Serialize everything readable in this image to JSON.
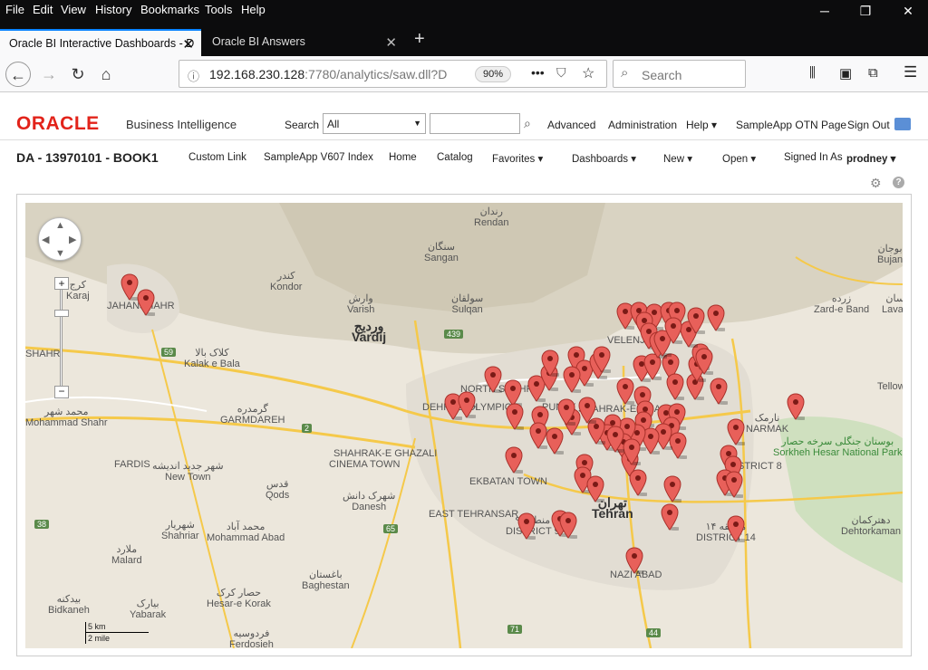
{
  "browser": {
    "menu": [
      "File",
      "Edit",
      "View",
      "History",
      "Bookmarks",
      "Tools",
      "Help"
    ],
    "tabs": [
      {
        "label": "Oracle BI Interactive Dashboards - D",
        "active": true
      },
      {
        "label": "Oracle BI Answers",
        "active": false
      }
    ],
    "url_host": "192.168.230.128",
    "url_rest": ":7780/analytics/saw.dll?D",
    "zoom": "90%",
    "search_placeholder": "Search"
  },
  "obi": {
    "logo": "ORACLE",
    "product": "Business Intelligence",
    "search_label": "Search",
    "search_scope": "All",
    "links": [
      "Advanced",
      "Administration",
      "Help",
      "SampleApp OTN Page",
      "Sign Out"
    ],
    "dashboard_title": "DA - 13970101 - BOOK1",
    "dash_links": [
      "Custom Link",
      "SampleApp V607 Index",
      "Home",
      "Catalog",
      "Favorites",
      "Dashboards",
      "New",
      "Open"
    ],
    "signed_in_label": "Signed In As",
    "user": "prodney"
  },
  "map": {
    "labels": [
      {
        "fa": "رندان",
        "en": "Rendan"
      },
      {
        "fa": "سنگان",
        "en": "Sangan"
      },
      {
        "fa": "کندر",
        "en": "Kondor"
      },
      {
        "fa": "وارش",
        "en": "Varish"
      },
      {
        "fa": "وردیج",
        "en": "Vardij"
      },
      {
        "fa": "سولقان",
        "en": "Sulqan"
      },
      {
        "fa": "کرج",
        "en": "Karaj"
      },
      {
        "fa": "کلاک بالا",
        "en": "Kalak e Bala"
      },
      {
        "fa": "گرمدره",
        "en": "GARMDAREH"
      },
      {
        "fa": "محمد شهر",
        "en": "Mohammad Shahr"
      },
      {
        "fa": "شهر جدید اندیشه",
        "en": "New Town"
      },
      {
        "fa": "قدس",
        "en": "Qods"
      },
      {
        "fa": "شهرک دانش",
        "en": "Danesh"
      },
      {
        "fa": "تهران",
        "en": "Tehran"
      },
      {
        "fa": "شهریار",
        "en": "Shahriar"
      },
      {
        "fa": "محمد آباد",
        "en": "Mohammad Abad"
      },
      {
        "fa": "ملارد",
        "en": "Malard"
      },
      {
        "fa": "باغستان",
        "en": "Baghestan"
      },
      {
        "fa": "بیدکنه",
        "en": "Bidkaneh"
      },
      {
        "fa": "بیارک",
        "en": "Yabarak"
      },
      {
        "fa": "حصار کرک",
        "en": "Hesar-e Korak"
      },
      {
        "fa": "فردوسیه",
        "en": "Ferdosieh"
      },
      {
        "fa": "بوجان",
        "en": "Bujan"
      },
      {
        "fa": "زرده",
        "en": "Zard-e Band"
      },
      {
        "fa": "لواسان",
        "en": "Lavasan"
      },
      {
        "fa": "",
        "en": "Tellow"
      },
      {
        "fa": "نارمک",
        "en": "NARMAK"
      },
      {
        "fa": "بوستان جنگلی سرخه حصار",
        "en": "Sorkheh Hesar National Park"
      },
      {
        "fa": "دهترکمان",
        "en": "Dehtorkaman"
      },
      {
        "fa": "",
        "en": "NAZI ABAD"
      },
      {
        "fa": "منطقه ۹",
        "en": "DISTRICT 9"
      },
      {
        "fa": "منطقه ۱۴",
        "en": "DISTRICT 14"
      },
      {
        "fa": "",
        "en": "DISTRICT 8"
      },
      {
        "fa": "",
        "en": "EKBATAN TOWN"
      },
      {
        "fa": "",
        "en": "EAST TEHRANSAR"
      },
      {
        "fa": "",
        "en": "CINEMA TOWN"
      },
      {
        "fa": "",
        "en": "OLYMPIC"
      },
      {
        "fa": "",
        "en": "PUNAK"
      },
      {
        "fa": "",
        "en": "SHAHRAK-E GHARB"
      },
      {
        "fa": "",
        "en": "VELENJ"
      },
      {
        "fa": "",
        "en": "DEHKADEH"
      },
      {
        "fa": "",
        "en": "SHAHR"
      },
      {
        "fa": "",
        "en": "FARDIS"
      },
      {
        "fa": "",
        "en": "SHAHRAK-E GHAZALI"
      },
      {
        "fa": "",
        "en": "JAHANSHAHR"
      },
      {
        "fa": "",
        "en": "NORTH SHAHR"
      }
    ],
    "road_numbers": [
      "439",
      "2",
      "59",
      "38",
      "65",
      "71",
      "44"
    ],
    "scale_km": "5 km",
    "scale_mi": "2 mile",
    "pin_count": 80
  }
}
